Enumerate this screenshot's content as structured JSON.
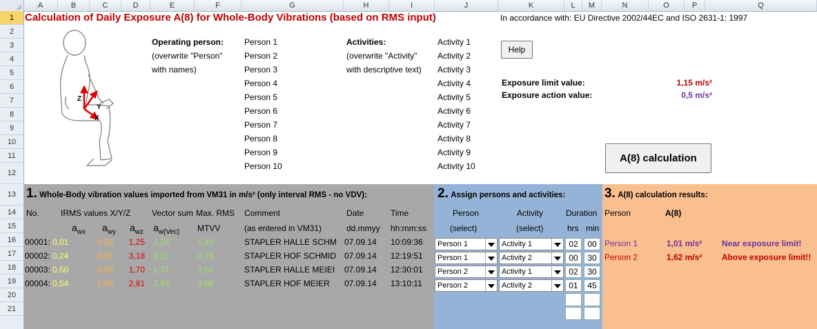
{
  "columns": [
    "A",
    "B",
    "C",
    "D",
    "E",
    "F",
    "G",
    "H",
    "I",
    "J",
    "K",
    "L",
    "M",
    "N",
    "O",
    "P",
    "Q"
  ],
  "rows": [
    "1",
    "2",
    "3",
    "4",
    "5",
    "6",
    "7",
    "8",
    "9",
    "10",
    "11",
    "12",
    "13",
    "14",
    "15",
    "16",
    "17",
    "18",
    "19",
    "20",
    "21"
  ],
  "selected_row": "1",
  "title": "Calculation of Daily Exposure A(8) for Whole-Body Vibrations (based on RMS input)",
  "accordance": "In accordance with: EU Directive 2002/44EC and ISO 2631-1: 1997",
  "help_label": "Help",
  "a8_button_label": "A(8) calculation",
  "operating": {
    "label": "Operating person:",
    "hint1": "(overwrite \"Person\"",
    "hint2": "with names)",
    "persons": [
      "Person 1",
      "Person 2",
      "Person 3",
      "Person 4",
      "Person 5",
      "Person 6",
      "Person 7",
      "Person 8",
      "Person 9",
      "Person 10"
    ]
  },
  "activities": {
    "label": "Activities:",
    "hint1": "(overwrite \"Activity\"",
    "hint2": "with descriptive text)",
    "items": [
      "Activity 1",
      "Activity 2",
      "Activity 3",
      "Activity 4",
      "Activity 5",
      "Activity 6",
      "Activity 7",
      "Activity 8",
      "Activity 9",
      "Activity 10"
    ]
  },
  "limits": {
    "limit_label": "Exposure limit value:",
    "limit_value": "1,15 m/s²",
    "action_label": "Exposure action value:",
    "action_value": "0,5 m/s²"
  },
  "axes": {
    "z": "Z",
    "y": "Y",
    "x": "X"
  },
  "section1": {
    "num": "1.",
    "title": "Whole-Body vibration values imported from VM31 in m/s² (only interval RMS - no VDV):",
    "h_no": "No.",
    "h_irms": "IRMS values X/Y/Z",
    "h_vector": "Vector sum",
    "h_maxrms": "Max. RMS",
    "h_comment": "Comment",
    "h_date": "Date",
    "h_time": "Time",
    "s_awx": "a",
    "s_awx_sub": "wx",
    "s_awy": "a",
    "s_awy_sub": "wy",
    "s_awz": "a",
    "s_awz_sub": "wz",
    "s_awvec": "a",
    "s_awvec_sub": "w(Vec)",
    "s_mtvv": "MTVV",
    "s_comment": "(as entered in VM31)",
    "s_date": "dd.mmyy",
    "s_time": "hh:mm:ss",
    "data": [
      {
        "no": "00001:",
        "awx": "0,01",
        "awy": "0,28",
        "awz": "1,25",
        "awv": "1,28",
        "mtvv": "1,32",
        "comment": "STAPLER HALLE  SCHM",
        "date": "07.09.14",
        "time": "10:09:36"
      },
      {
        "no": "00002:",
        "awx": "0,24",
        "awy": "0,39",
        "awz": "3,18",
        "awv": "3,18",
        "mtvv": "4,78",
        "comment": "STAPLER HOF  SCHMID",
        "date": "07.09.14",
        "time": "12:19:51"
      },
      {
        "no": "00003:",
        "awx": "0,50",
        "awy": "0,93",
        "awz": "1,70",
        "awv": "1,71",
        "mtvv": "2,01",
        "comment": "STAPLER HALLE  MEIEI",
        "date": "07.09.14",
        "time": "12:30:01"
      },
      {
        "no": "00004:",
        "awx": "0,54",
        "awy": "1,06",
        "awz": "2,81",
        "awv": "2,93",
        "mtvv": "3,96",
        "comment": "STAPLER HOF  MEIER",
        "date": "07.09.14",
        "time": "13:10:11"
      }
    ]
  },
  "section2": {
    "num": "2.",
    "title": "Assign persons and activities:",
    "h_person": "Person",
    "h_activity": "Activity",
    "h_duration": "Duration",
    "s_person": "(select)",
    "s_activity": "(select)",
    "s_hrs": "hrs",
    "s_min": "min",
    "rows": [
      {
        "person": "Person 1",
        "activity": "Activity 1",
        "hrs": "02",
        "min": "00"
      },
      {
        "person": "Person 1",
        "activity": "Activity 2",
        "hrs": "00",
        "min": "30"
      },
      {
        "person": "Person 2",
        "activity": "Activity 1",
        "hrs": "02",
        "min": "30"
      },
      {
        "person": "Person 2",
        "activity": "Activity 2",
        "hrs": "01",
        "min": "45"
      }
    ]
  },
  "section3": {
    "num": "3.",
    "title": "A(8) calculation results:",
    "h_person": "Person",
    "h_a8": "A(8)",
    "results": [
      {
        "person": "Person 1",
        "value": "1,01 m/s²",
        "note": "Near exposure limit!"
      },
      {
        "person": "Person 2",
        "value": "1,62 m/s²",
        "note": "Above exposure limit!!"
      }
    ]
  }
}
